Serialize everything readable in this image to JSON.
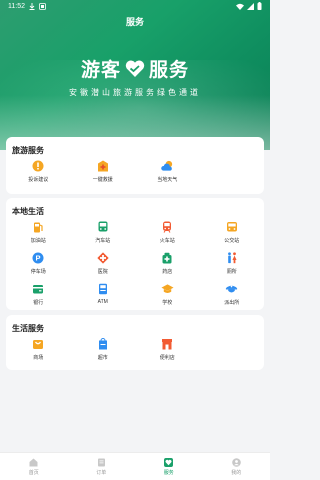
{
  "status_bar": {
    "time": "11:52"
  },
  "header": {
    "title": "服务"
  },
  "hero": {
    "title_left": "游客",
    "title_right": "服务",
    "subtitle": "安徽潜山旅游服务绿色通道"
  },
  "sections": {
    "travel": {
      "title": "旅游服务",
      "items": [
        {
          "label": "投诉建议"
        },
        {
          "label": "一键救援"
        },
        {
          "label": "当地天气"
        }
      ]
    },
    "local": {
      "title": "本地生活",
      "items": [
        {
          "label": "加油站"
        },
        {
          "label": "汽车站"
        },
        {
          "label": "火车站"
        },
        {
          "label": "公交站"
        },
        {
          "label": "停车场"
        },
        {
          "label": "医院"
        },
        {
          "label": "药店"
        },
        {
          "label": "厕所"
        },
        {
          "label": "银行"
        },
        {
          "label": "ATM"
        },
        {
          "label": "学校"
        },
        {
          "label": "派出所"
        }
      ]
    },
    "life": {
      "title": "生活服务",
      "items": [
        {
          "label": "商场"
        },
        {
          "label": "超市"
        },
        {
          "label": "便利店"
        }
      ]
    }
  },
  "tabbar": {
    "items": [
      {
        "label": "首页"
      },
      {
        "label": "订单"
      },
      {
        "label": "服务"
      },
      {
        "label": "我的"
      }
    ]
  },
  "colors": {
    "primary": "#1aa06a",
    "orange": "#f5a623",
    "red": "#f25b33",
    "blue": "#2f8df0"
  }
}
